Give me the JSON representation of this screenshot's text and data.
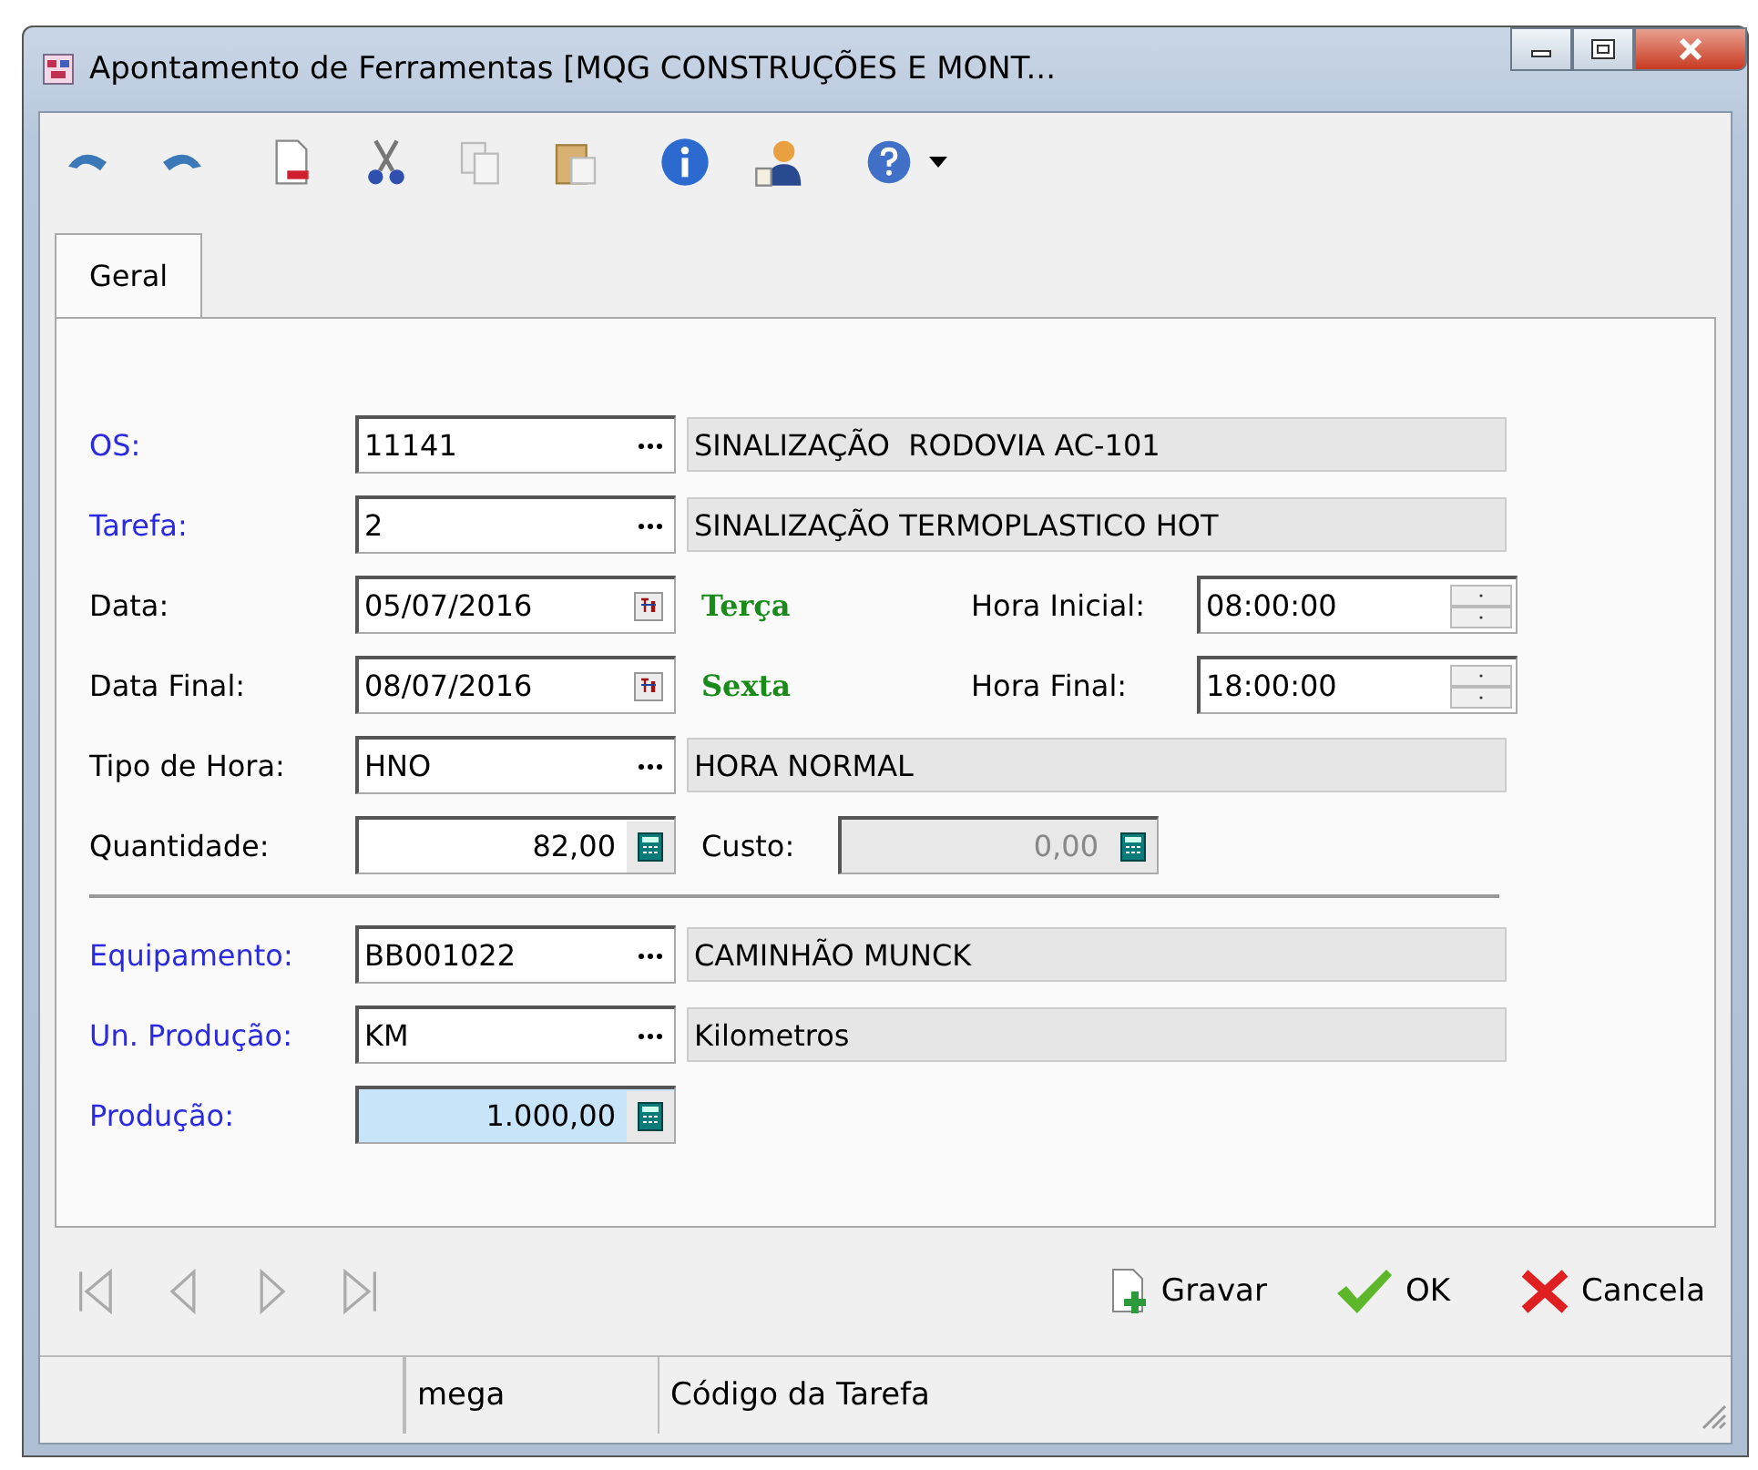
{
  "window": {
    "title": "Apontamento de Ferramentas [MQG CONSTRUÇÕES E MONT..."
  },
  "tabs": [
    {
      "label": "Geral",
      "selected": true
    }
  ],
  "form": {
    "rows": [
      {
        "kind": "lookup",
        "label": "OS:",
        "required": true,
        "code": "11141",
        "description": "SINALIZAÇÃO  RODOVIA AC-101"
      },
      {
        "kind": "lookup",
        "label": "Tarefa:",
        "required": true,
        "code": "2",
        "description": "SINALIZAÇÃO TERMOPLASTICO HOT"
      },
      {
        "kind": "date",
        "label": "Data:",
        "required": false,
        "date": "05/07/2016",
        "weekday": "Terça",
        "time_label": "Hora Inicial:",
        "time": "08:00:00"
      },
      {
        "kind": "date",
        "label": "Data Final:",
        "required": false,
        "date": "08/07/2016",
        "weekday": "Sexta",
        "time_label": "Hora Final:",
        "time": "18:00:00"
      },
      {
        "kind": "lookup",
        "label": "Tipo de Hora:",
        "required": false,
        "code": "HNO",
        "description": "HORA NORMAL"
      },
      {
        "kind": "number",
        "label": "Quantidade:",
        "required": false,
        "value": "82,00",
        "focused": false,
        "extra": {
          "label": "Custo:",
          "value": "0,00",
          "disabled": true
        }
      },
      {
        "kind": "separator"
      },
      {
        "kind": "lookup",
        "label": "Equipamento:",
        "required": true,
        "code": "BB001022",
        "description": "CAMINHÃO MUNCK"
      },
      {
        "kind": "lookup",
        "label": "Un. Produção:",
        "required": true,
        "code": "KM",
        "description": "Kilometros"
      },
      {
        "kind": "number",
        "label": "Produção:",
        "required": true,
        "value": "1.000,00",
        "focused": true
      }
    ]
  },
  "buttons": [
    {
      "kind": "save",
      "label": "Gravar"
    },
    {
      "kind": "ok",
      "label": "OK"
    },
    {
      "kind": "cancel",
      "label": "Cancela"
    }
  ],
  "status_bar": {
    "user": "mega",
    "hint": "Código da Tarefa"
  }
}
